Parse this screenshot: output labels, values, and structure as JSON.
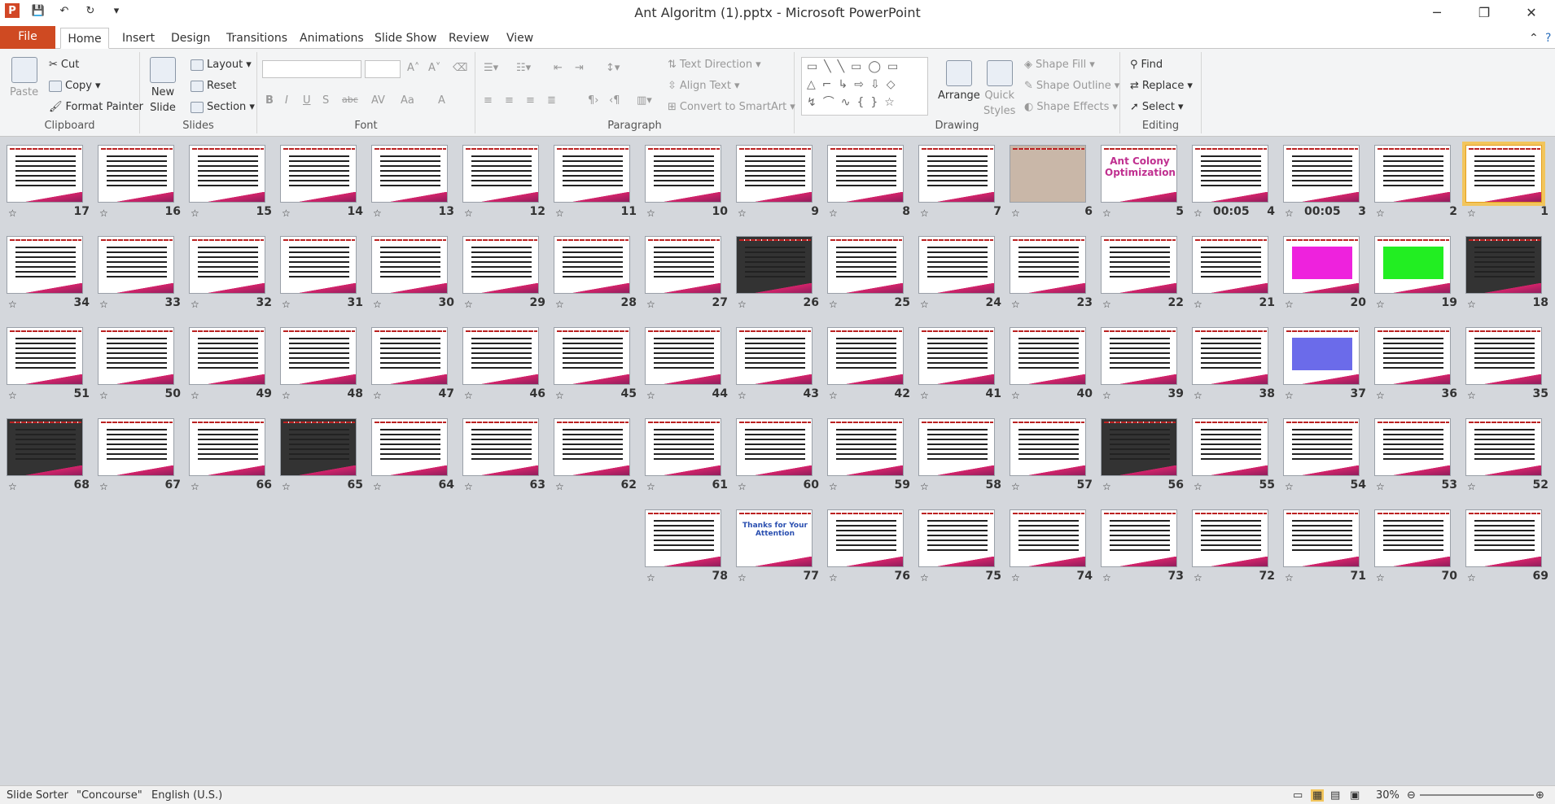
{
  "window": {
    "title": "Ant Algoritm (1).pptx - Microsoft PowerPoint",
    "minimize": "─",
    "restore": "❐",
    "close": "✕"
  },
  "tabs": [
    {
      "label": "File"
    },
    {
      "label": "Home"
    },
    {
      "label": "Insert"
    },
    {
      "label": "Design"
    },
    {
      "label": "Transitions"
    },
    {
      "label": "Animations"
    },
    {
      "label": "Slide Show"
    },
    {
      "label": "Review"
    },
    {
      "label": "View"
    }
  ],
  "ribbon": {
    "clipboard": {
      "label": "Clipboard",
      "paste": "Paste",
      "cut": "Cut",
      "copy": "Copy",
      "format_painter": "Format Painter"
    },
    "slides": {
      "label": "Slides",
      "new_slide_1": "New",
      "new_slide_2": "Slide",
      "layout": "Layout",
      "reset": "Reset",
      "section": "Section"
    },
    "font": {
      "label": "Font",
      "bold": "B",
      "italic": "I",
      "underline": "U",
      "shadow": "S",
      "strike": "abc",
      "spacing": "AV",
      "case": "Aa",
      "color": "A"
    },
    "paragraph": {
      "label": "Paragraph",
      "text_direction": "Text Direction",
      "align_text": "Align Text",
      "convert": "Convert to SmartArt"
    },
    "drawing": {
      "label": "Drawing",
      "arrange": "Arrange",
      "quick_styles_1": "Quick",
      "quick_styles_2": "Styles",
      "shape_fill": "Shape Fill",
      "shape_outline": "Shape Outline",
      "shape_effects": "Shape Effects"
    },
    "editing": {
      "label": "Editing",
      "find": "Find",
      "replace": "Replace",
      "select": "Select"
    }
  },
  "slides": [
    {
      "n": "1"
    },
    {
      "n": "2"
    },
    {
      "n": "3",
      "time": "00:05"
    },
    {
      "n": "4",
      "time": "00:05"
    },
    {
      "n": "5"
    },
    {
      "n": "6"
    },
    {
      "n": "7"
    },
    {
      "n": "8"
    },
    {
      "n": "9"
    },
    {
      "n": "10"
    },
    {
      "n": "11"
    },
    {
      "n": "12"
    },
    {
      "n": "13"
    },
    {
      "n": "14"
    },
    {
      "n": "15"
    },
    {
      "n": "16"
    },
    {
      "n": "17"
    },
    {
      "n": "18"
    },
    {
      "n": "19"
    },
    {
      "n": "20"
    },
    {
      "n": "21"
    },
    {
      "n": "22"
    },
    {
      "n": "23"
    },
    {
      "n": "24"
    },
    {
      "n": "25"
    },
    {
      "n": "26"
    },
    {
      "n": "27"
    },
    {
      "n": "28"
    },
    {
      "n": "29"
    },
    {
      "n": "30"
    },
    {
      "n": "31"
    },
    {
      "n": "32"
    },
    {
      "n": "33"
    },
    {
      "n": "34"
    },
    {
      "n": "35"
    },
    {
      "n": "36"
    },
    {
      "n": "37"
    },
    {
      "n": "38"
    },
    {
      "n": "39"
    },
    {
      "n": "40"
    },
    {
      "n": "41"
    },
    {
      "n": "42"
    },
    {
      "n": "43"
    },
    {
      "n": "44"
    },
    {
      "n": "45"
    },
    {
      "n": "46"
    },
    {
      "n": "47"
    },
    {
      "n": "48"
    },
    {
      "n": "49"
    },
    {
      "n": "50"
    },
    {
      "n": "51"
    },
    {
      "n": "52"
    },
    {
      "n": "53"
    },
    {
      "n": "54"
    },
    {
      "n": "55"
    },
    {
      "n": "56"
    },
    {
      "n": "57"
    },
    {
      "n": "58"
    },
    {
      "n": "59"
    },
    {
      "n": "60"
    },
    {
      "n": "61"
    },
    {
      "n": "62"
    },
    {
      "n": "63"
    },
    {
      "n": "64"
    },
    {
      "n": "65"
    },
    {
      "n": "66"
    },
    {
      "n": "67"
    },
    {
      "n": "68"
    },
    {
      "n": "69"
    },
    {
      "n": "70"
    },
    {
      "n": "71"
    },
    {
      "n": "72"
    },
    {
      "n": "73"
    },
    {
      "n": "74"
    },
    {
      "n": "75"
    },
    {
      "n": "76"
    },
    {
      "n": "77"
    },
    {
      "n": "78"
    }
  ],
  "slide_text": {
    "s5": "Ant Colony Optimization",
    "s77": "Thanks for Your Attention"
  },
  "status": {
    "view": "Slide Sorter",
    "theme": "\"Concourse\"",
    "language": "English (U.S.)",
    "zoom": "30%"
  }
}
